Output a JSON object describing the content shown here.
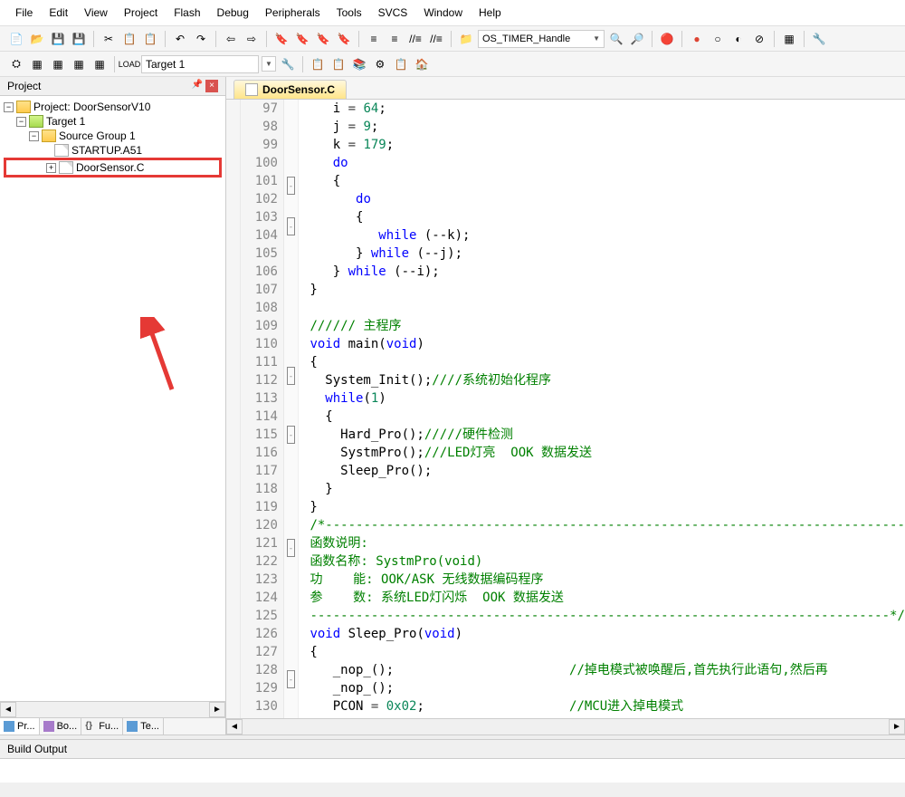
{
  "menu": [
    "File",
    "Edit",
    "View",
    "Project",
    "Flash",
    "Debug",
    "Peripherals",
    "Tools",
    "SVCS",
    "Window",
    "Help"
  ],
  "toolbar1": {
    "dropdown_value": "OS_TIMER_Handle"
  },
  "toolbar2": {
    "target_value": "Target 1"
  },
  "project_panel": {
    "title": "Project",
    "root": "Project: DoorSensorV10",
    "target": "Target 1",
    "group": "Source Group 1",
    "file1": "STARTUP.A51",
    "file2": "DoorSensor.C",
    "tabs": [
      "Pr...",
      "Bo...",
      "Fu...",
      "Te..."
    ]
  },
  "editor": {
    "tab_name": "DoorSensor.C",
    "first_line": 97,
    "lines": [
      {
        "n": 97,
        "fold": "",
        "raw": "    i = 64;",
        "segs": [
          {
            "t": "    i "
          },
          {
            "t": "=",
            "c": "op"
          },
          {
            "t": " "
          },
          {
            "t": "64",
            "c": "num"
          },
          {
            "t": ";"
          }
        ]
      },
      {
        "n": 98,
        "fold": "",
        "raw": "    j = 9;",
        "segs": [
          {
            "t": "    j "
          },
          {
            "t": "=",
            "c": "op"
          },
          {
            "t": " "
          },
          {
            "t": "9",
            "c": "num"
          },
          {
            "t": ";"
          }
        ]
      },
      {
        "n": 99,
        "fold": "",
        "raw": "    k = 179;",
        "segs": [
          {
            "t": "    k "
          },
          {
            "t": "=",
            "c": "op"
          },
          {
            "t": " "
          },
          {
            "t": "179",
            "c": "num"
          },
          {
            "t": ";"
          }
        ]
      },
      {
        "n": 100,
        "fold": "",
        "raw": "    do",
        "segs": [
          {
            "t": "    "
          },
          {
            "t": "do",
            "c": "kw"
          }
        ]
      },
      {
        "n": 101,
        "fold": "-",
        "raw": "    {",
        "segs": [
          {
            "t": "    {"
          }
        ]
      },
      {
        "n": 102,
        "fold": "",
        "raw": "       do",
        "segs": [
          {
            "t": "       "
          },
          {
            "t": "do",
            "c": "kw"
          }
        ]
      },
      {
        "n": 103,
        "fold": "-",
        "raw": "       {",
        "segs": [
          {
            "t": "       {"
          }
        ]
      },
      {
        "n": 104,
        "fold": "",
        "raw": "          while (--k);",
        "segs": [
          {
            "t": "          "
          },
          {
            "t": "while",
            "c": "kw"
          },
          {
            "t": " (--k);"
          }
        ]
      },
      {
        "n": 105,
        "fold": "",
        "raw": "       } while (--j);",
        "segs": [
          {
            "t": "       } "
          },
          {
            "t": "while",
            "c": "kw"
          },
          {
            "t": " (--j);"
          }
        ]
      },
      {
        "n": 106,
        "fold": "",
        "raw": "    } while (--i);",
        "segs": [
          {
            "t": "    } "
          },
          {
            "t": "while",
            "c": "kw"
          },
          {
            "t": " (--i);"
          }
        ]
      },
      {
        "n": 107,
        "fold": "",
        "raw": " }",
        "segs": [
          {
            "t": " }"
          }
        ]
      },
      {
        "n": 108,
        "fold": "",
        "raw": "",
        "segs": [
          {
            "t": ""
          }
        ]
      },
      {
        "n": 109,
        "fold": "",
        "raw": " ////// 主程序",
        "segs": [
          {
            "t": " "
          },
          {
            "t": "////// 主程序",
            "c": "cmt"
          }
        ]
      },
      {
        "n": 110,
        "fold": "",
        "raw": " void main(void)",
        "segs": [
          {
            "t": " "
          },
          {
            "t": "void",
            "c": "kw"
          },
          {
            "t": " main("
          },
          {
            "t": "void",
            "c": "kw"
          },
          {
            "t": ")"
          }
        ]
      },
      {
        "n": 111,
        "fold": "-",
        "raw": " {",
        "segs": [
          {
            "t": " {"
          }
        ]
      },
      {
        "n": 112,
        "fold": "",
        "raw": "   System_Init();////系统初始化程序",
        "segs": [
          {
            "t": "   System_Init();"
          },
          {
            "t": "////系统初始化程序",
            "c": "cmt"
          }
        ]
      },
      {
        "n": 113,
        "fold": "",
        "raw": "   while(1)",
        "segs": [
          {
            "t": "   "
          },
          {
            "t": "while",
            "c": "kw"
          },
          {
            "t": "("
          },
          {
            "t": "1",
            "c": "num"
          },
          {
            "t": ")"
          }
        ]
      },
      {
        "n": 114,
        "fold": "-",
        "raw": "   {",
        "segs": [
          {
            "t": "   {"
          }
        ]
      },
      {
        "n": 115,
        "fold": "",
        "raw": "     Hard_Pro();/////硬件检测",
        "segs": [
          {
            "t": "     Hard_Pro();"
          },
          {
            "t": "/////硬件检测",
            "c": "cmt"
          }
        ]
      },
      {
        "n": 116,
        "fold": "",
        "raw": "     SystmPro();///LED灯亮  OOK 数据发送",
        "segs": [
          {
            "t": "     SystmPro();"
          },
          {
            "t": "///LED灯亮  OOK 数据发送",
            "c": "cmt"
          }
        ]
      },
      {
        "n": 117,
        "fold": "",
        "raw": "     Sleep_Pro();",
        "segs": [
          {
            "t": "     Sleep_Pro();"
          }
        ]
      },
      {
        "n": 118,
        "fold": "",
        "raw": "   }",
        "segs": [
          {
            "t": "   }"
          }
        ]
      },
      {
        "n": 119,
        "fold": "",
        "raw": " }",
        "segs": [
          {
            "t": " }"
          }
        ]
      },
      {
        "n": 120,
        "fold": "-",
        "raw": " /*----------------------------------------------------------------------------",
        "segs": [
          {
            "t": " "
          },
          {
            "t": "/*----------------------------------------------------------------------------",
            "c": "cmt"
          }
        ]
      },
      {
        "n": 121,
        "fold": "",
        "raw": " 函数说明:",
        "segs": [
          {
            "t": " "
          },
          {
            "t": "函数说明:",
            "c": "cmt"
          }
        ]
      },
      {
        "n": 122,
        "fold": "",
        "raw": " 函数名称: SystmPro(void)",
        "segs": [
          {
            "t": " "
          },
          {
            "t": "函数名称: SystmPro(void)",
            "c": "cmt"
          }
        ]
      },
      {
        "n": 123,
        "fold": "",
        "raw": " 功    能: OOK/ASK 无线数据编码程序",
        "segs": [
          {
            "t": " "
          },
          {
            "t": "功    能: OOK/ASK 无线数据编码程序",
            "c": "cmt"
          }
        ]
      },
      {
        "n": 124,
        "fold": "",
        "raw": " 参    数: 系统LED灯闪烁  OOK 数据发送",
        "segs": [
          {
            "t": " "
          },
          {
            "t": "参    数: 系统LED灯闪烁  OOK 数据发送",
            "c": "cmt"
          }
        ]
      },
      {
        "n": 125,
        "fold": "",
        "raw": " ----------------------------------------------------------------------------*/",
        "segs": [
          {
            "t": " "
          },
          {
            "t": "----------------------------------------------------------------------------*/",
            "c": "cmt"
          }
        ]
      },
      {
        "n": 126,
        "fold": "",
        "raw": " void Sleep_Pro(void)",
        "segs": [
          {
            "t": " "
          },
          {
            "t": "void",
            "c": "kw"
          },
          {
            "t": " Sleep_Pro("
          },
          {
            "t": "void",
            "c": "kw"
          },
          {
            "t": ")"
          }
        ]
      },
      {
        "n": 127,
        "fold": "-",
        "raw": " {",
        "segs": [
          {
            "t": " {"
          }
        ]
      },
      {
        "n": 128,
        "fold": "",
        "raw": "    _nop_();                       //掉电模式被唤醒后,首先执行此语句,然后再",
        "segs": [
          {
            "t": "    _nop_();                       "
          },
          {
            "t": "//掉电模式被唤醒后,首先执行此语句,然后再",
            "c": "cmt"
          }
        ]
      },
      {
        "n": 129,
        "fold": "",
        "raw": "    _nop_();",
        "segs": [
          {
            "t": "    _nop_();"
          }
        ]
      },
      {
        "n": 130,
        "fold": "",
        "raw": "    PCON = 0x02;                   //MCU进入掉电模式",
        "segs": [
          {
            "t": "    PCON "
          },
          {
            "t": "=",
            "c": "op"
          },
          {
            "t": " "
          },
          {
            "t": "0x02",
            "c": "num"
          },
          {
            "t": ";                   "
          },
          {
            "t": "//MCU进入掉电模式",
            "c": "cmt"
          }
        ]
      }
    ]
  },
  "build_output": {
    "title": "Build Output"
  }
}
